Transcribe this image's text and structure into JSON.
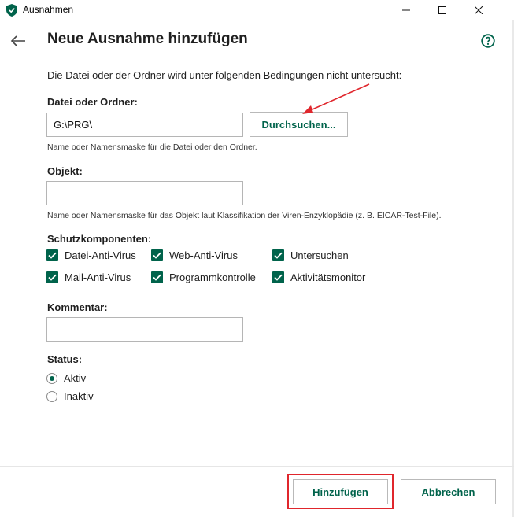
{
  "window": {
    "title": "Ausnahmen"
  },
  "header": {
    "title": "Neue Ausnahme hinzufügen"
  },
  "intro": "Die Datei oder der Ordner wird unter folgenden Bedingungen nicht untersucht:",
  "file": {
    "label": "Datei oder Ordner:",
    "value": "G:\\PRG\\",
    "browse_label": "Durchsuchen...",
    "hint": "Name oder Namensmaske für die Datei oder den Ordner."
  },
  "object": {
    "label": "Objekt:",
    "value": "",
    "hint": "Name oder Namensmaske für das Objekt laut Klassifikation der Viren-Enzyklopädie (z. B. EICAR-Test-File)."
  },
  "components": {
    "label": "Schutzkomponenten:",
    "items": [
      {
        "label": "Datei-Anti-Virus",
        "checked": true
      },
      {
        "label": "Web-Anti-Virus",
        "checked": true
      },
      {
        "label": "Untersuchen",
        "checked": true
      },
      {
        "label": "Mail-Anti-Virus",
        "checked": true
      },
      {
        "label": "Programmkontrolle",
        "checked": true
      },
      {
        "label": "Aktivitätsmonitor",
        "checked": true
      }
    ]
  },
  "comment": {
    "label": "Kommentar:",
    "value": ""
  },
  "status": {
    "label": "Status:",
    "options": [
      {
        "label": "Aktiv",
        "selected": true
      },
      {
        "label": "Inaktiv",
        "selected": false
      }
    ]
  },
  "footer": {
    "add_label": "Hinzufügen",
    "cancel_label": "Abbrechen"
  },
  "colors": {
    "accent": "#00634b",
    "annotation": "#e0262c"
  }
}
